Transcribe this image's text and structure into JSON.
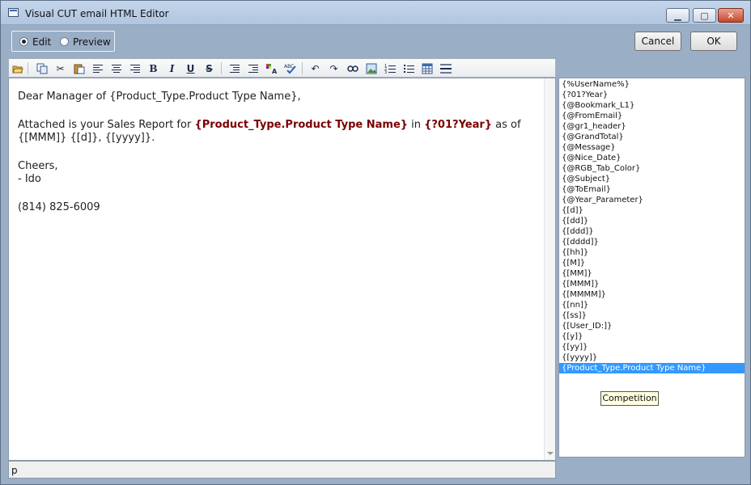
{
  "window": {
    "title": "Visual CUT email HTML Editor"
  },
  "mode": {
    "edit_label": "Edit",
    "preview_label": "Preview",
    "selected": "edit"
  },
  "buttons": {
    "cancel": "Cancel",
    "ok": "OK"
  },
  "toolbar": {
    "bold": "B",
    "italic": "I",
    "underline": "U",
    "strike": "S"
  },
  "editor": {
    "line1": "Dear Manager of {Product_Type.Product Type Name},",
    "line2_prefix": "Attached is your Sales Report for ",
    "line2_field1": "{Product_Type.Product Type Name}",
    "line2_mid": " in ",
    "line2_field2": "{?01?Year}",
    "line2_suffix": " as of",
    "line3": "{[MMM]} {[d]}, {[yyyy]}.",
    "line4": "Cheers,",
    "line5": "- Ido",
    "line6": "(814) 825-6009"
  },
  "status": {
    "tag": "p"
  },
  "field_list": [
    "{%UserName%}",
    "{?01?Year}",
    "{@Bookmark_L1}",
    "{@FromEmail}",
    "{@gr1_header}",
    "{@GrandTotal}",
    "{@Message}",
    "{@Nice_Date}",
    "{@RGB_Tab_Color}",
    "{@Subject}",
    "{@ToEmail}",
    "{@Year_Parameter}",
    "{[d]}",
    "{[dd]}",
    "{[ddd]}",
    "{[dddd]}",
    "{[hh]}",
    "{[M]}",
    "{[MM]}",
    "{[MMM]}",
    "{[MMMM]}",
    "{[nn]}",
    "{[ss]}",
    "{[User_ID:]}",
    "{[y]}",
    "{[yy]}",
    "{[yyyy]}",
    "{Product_Type.Product Type Name}"
  ],
  "field_list_selected_index": 27,
  "tooltip": "Competition"
}
